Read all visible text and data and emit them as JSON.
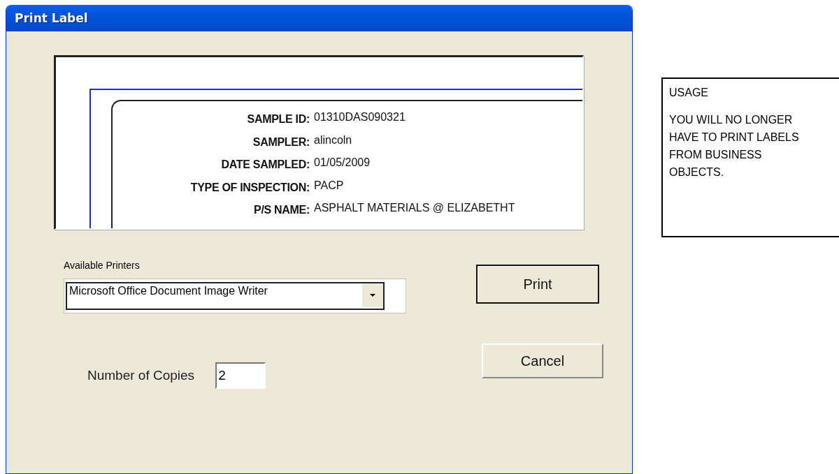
{
  "window": {
    "title": "Print Label"
  },
  "label_preview": {
    "fields": [
      {
        "label": "SAMPLE ID:",
        "value": "01310DAS090321"
      },
      {
        "label": "SAMPLER:",
        "value": "alincoln"
      },
      {
        "label": "DATE SAMPLED:",
        "value": "01/05/2009"
      },
      {
        "label": "TYPE OF INSPECTION:",
        "value": "PACP"
      },
      {
        "label": "P/S NAME:",
        "value": "ASPHALT MATERIALS @ ELIZABETHT"
      }
    ]
  },
  "printers": {
    "label": "Available Printers",
    "value": "Microsoft Office Document Image Writer"
  },
  "copies": {
    "label": "Number of Copies",
    "value": "2"
  },
  "buttons": [
    {
      "label": "Print",
      "kind": "default"
    },
    {
      "label": "Cancel",
      "kind": "normal"
    }
  ],
  "usage": {
    "heading": "USAGE",
    "message": "YOU WILL NO LONGER HAVE TO PRINT LABELS FROM BUSINESS OBJECTS."
  }
}
